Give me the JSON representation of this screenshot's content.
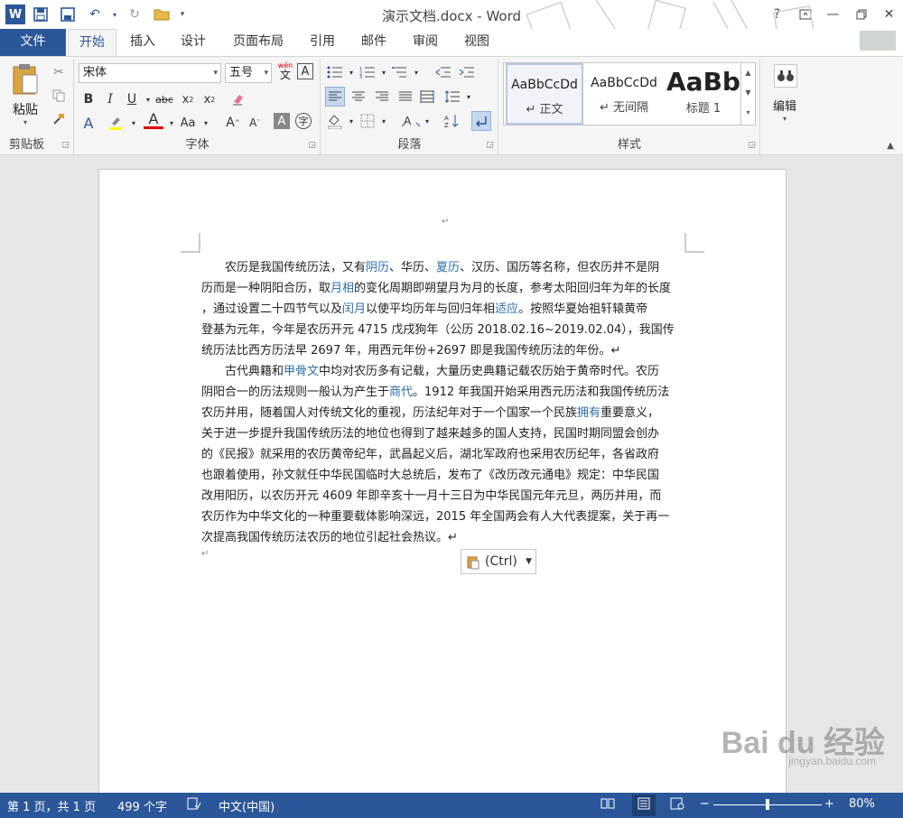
{
  "app": {
    "title": "演示文档.docx - Word",
    "logo": "W",
    "colors": {
      "brand": "#2b579a",
      "link": "#2b6ea7",
      "status_bar": "#2b579a"
    }
  },
  "tabs": [
    {
      "label": "文件"
    },
    {
      "label": "开始"
    },
    {
      "label": "插入"
    },
    {
      "label": "设计"
    },
    {
      "label": "页面布局"
    },
    {
      "label": "引用"
    },
    {
      "label": "邮件"
    },
    {
      "label": "审阅"
    },
    {
      "label": "视图"
    }
  ],
  "ribbon": {
    "clipboard": {
      "label": "剪贴板",
      "paste_label": "粘贴"
    },
    "font": {
      "label": "字体",
      "font_name": "宋体",
      "font_size": "五号",
      "phonetic": "wén",
      "phonetic2": "文"
    },
    "paragraph": {
      "label": "段落"
    },
    "styles": {
      "label": "样式",
      "items": [
        {
          "sample": "AaBbCcDd",
          "name": "↵ 正文"
        },
        {
          "sample": "AaBbCcDd",
          "name": "↵ 无间隔"
        },
        {
          "sample": "AaBb",
          "name": "标题 1"
        }
      ]
    },
    "editing": {
      "label": "编辑"
    }
  },
  "document": {
    "para1": [
      [
        "　　农历是我国传统历法，又有",
        "阴历",
        "、华历、",
        "夏历",
        "、汉历、国历等名称，但农历并不是阴"
      ],
      [
        "历而是一种阴阳合历，取",
        "月相",
        "的变化周期即朔望月为月的长度，参考太阳回归年为年的长度"
      ],
      [
        "，通过设置二十四节气以及",
        "闰月",
        "以使平均历年与回归年相",
        "适应",
        "。按照华夏始祖轩辕黄帝"
      ],
      [
        "登基为元年，今年是农历开元 4715 戊戌狗年（公历 2018.02.16~2019.02.04），我国传"
      ],
      [
        "统历法比西方历法早 2697 年，用西元年份+2697 即是我国传统历法的年份。↵"
      ]
    ],
    "para2": [
      [
        "　　古代典籍和",
        "甲骨文",
        "中均对农历多有记载，大量历史典籍记载农历始于黄帝时代。农历"
      ],
      [
        "阴阳合一的历法规则一般认为产生于",
        "商代",
        "。1912 年我国开始采用西元历法和我国传统历法"
      ],
      [
        "农历并用，随着国人对传统文化的重视，历法纪年对于一个国家一个民族",
        "拥有",
        "重要意义，"
      ],
      [
        "关于进一步提升我国传统历法的地位也得到了越来越多的国人支持，民国时期同盟会创办"
      ],
      [
        "的《民报》就采用的农历黄帝纪年，武昌起义后，湖北军政府也采用农历纪年，各省政府"
      ],
      [
        "也跟着使用，孙文就任中华民国临时大总统后，发布了《改历改元通电》规定：中华民国"
      ],
      [
        "改用阳历，以农历开元 4609 年即辛亥十一月十三日为中华民国元年元旦，两历并用，而"
      ],
      [
        "农历作为中华文化的一种重要载体影响深远，2015 年全国两会有人大代表提案，关于再一"
      ],
      [
        "次提高我国传统历法农历的地位引起社会热议。↵"
      ]
    ],
    "top_mark": "↵",
    "end_mark": "↵",
    "paste_options": "(Ctrl)"
  },
  "status": {
    "page": "第 1 页，共 1 页",
    "words": "499 个字",
    "language": "中文(中国)",
    "zoom": "80%",
    "zoom_level": 0.5
  },
  "watermark": {
    "brand": "Bai du 经验",
    "url": "jingyan.baidu.com"
  }
}
